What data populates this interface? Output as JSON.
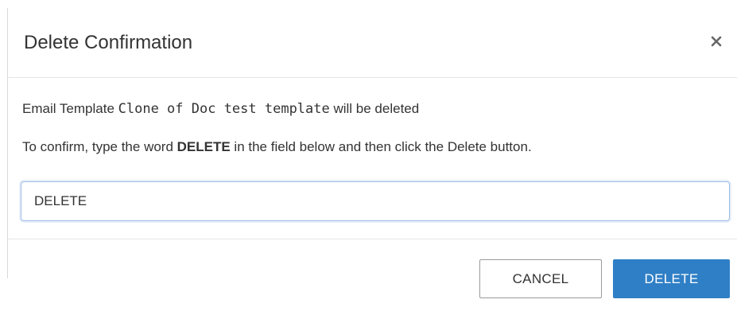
{
  "dialog": {
    "title": "Delete Confirmation",
    "close_icon": "close-icon"
  },
  "body": {
    "line1_prefix": "Email Template ",
    "line1_template_name": "Clone of Doc test template",
    "line1_suffix": " will be deleted",
    "line2_prefix": "To confirm, type the word ",
    "line2_keyword": "DELETE",
    "line2_suffix": " in the field below and then click the Delete button.",
    "input_value": "DELETE"
  },
  "footer": {
    "cancel_label": "CANCEL",
    "delete_label": "DELETE"
  },
  "colors": {
    "primary": "#2f7fc6",
    "border": "#e5e5e5",
    "text": "#333333"
  }
}
